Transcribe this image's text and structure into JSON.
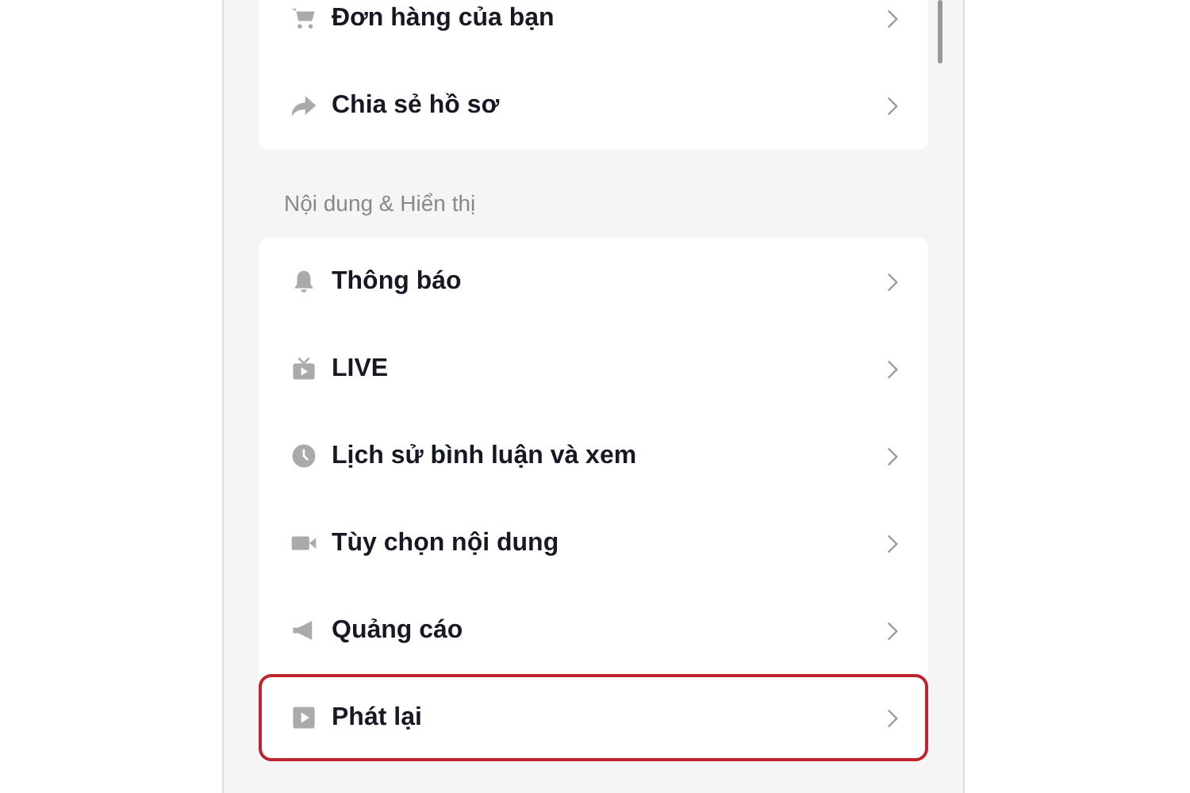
{
  "groups": [
    {
      "items": [
        {
          "kind": "cart",
          "label": "Đơn hàng của bạn",
          "highlighted": false
        },
        {
          "kind": "share",
          "label": "Chia sẻ hồ sơ",
          "highlighted": false
        }
      ]
    },
    {
      "header": "Nội dung & Hiển thị",
      "items": [
        {
          "kind": "bell",
          "label": "Thông báo",
          "highlighted": false
        },
        {
          "kind": "tv",
          "label": "LIVE",
          "highlighted": false
        },
        {
          "kind": "clock",
          "label": "Lịch sử bình luận và xem",
          "highlighted": false
        },
        {
          "kind": "camera",
          "label": "Tùy chọn nội dung",
          "highlighted": false
        },
        {
          "kind": "megaphone",
          "label": "Quảng cáo",
          "highlighted": false
        },
        {
          "kind": "play",
          "label": "Phát lại",
          "highlighted": true
        }
      ]
    }
  ]
}
